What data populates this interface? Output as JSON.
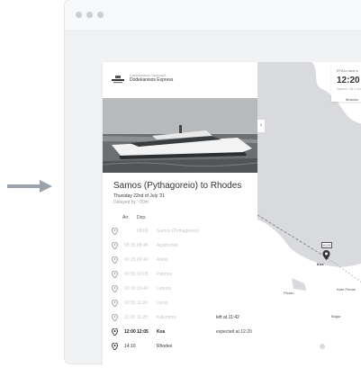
{
  "operator": {
    "small": "Dodekanisos Seaways",
    "name": "Dodekanisos Express"
  },
  "route": {
    "title": "Samos (Pythagoreio) to Rhodes",
    "date": "Thursday 22nd of July '21",
    "delay": "Delayed by ~20m"
  },
  "table": {
    "arr_header": "Arr.",
    "dep_header": "Dep."
  },
  "stops": [
    {
      "arr": "",
      "dep": "08:00",
      "name": "Samos (Pythagoreio)",
      "note": "",
      "state": "past"
    },
    {
      "arr": "08:35",
      "dep": "08:45",
      "name": "Agathonisi",
      "note": "",
      "state": "past"
    },
    {
      "arr": "09:25",
      "dep": "09:40",
      "name": "Arkioi",
      "note": "",
      "state": "past"
    },
    {
      "arr": "09:55",
      "dep": "10:05",
      "name": "Patmos",
      "note": "",
      "state": "past"
    },
    {
      "arr": "10:30",
      "dep": "10:40",
      "name": "Leipsoi",
      "note": "",
      "state": "past"
    },
    {
      "arr": "10:55",
      "dep": "11:00",
      "name": "Leros",
      "note": "",
      "state": "past"
    },
    {
      "arr": "11:20",
      "dep": "11:25",
      "name": "Kalymnos",
      "note": "left at 11:42",
      "state": "past"
    },
    {
      "arr": "12:00",
      "dep": "12:05",
      "name": "Kos",
      "note": "expected at 12:20",
      "state": "current"
    },
    {
      "arr": "14:10",
      "dep": "",
      "name": "Rhodes",
      "note": "",
      "state": "future"
    }
  ],
  "map": {
    "eta_label": "ETA to next s",
    "eta_time": "12:20",
    "eta_speed": "Speed: 28.3 kn",
    "labels": {
      "moscia": "Mosclia",
      "kos": "Kos",
      "kos_tag": "KOS",
      "plaran": "Plaran",
      "kato_prinari": "Kato Prinari",
      "bagia": "Bagia"
    }
  },
  "colors": {
    "pin": "#333333",
    "water": "#d8dadd",
    "land": "#ffffff"
  }
}
